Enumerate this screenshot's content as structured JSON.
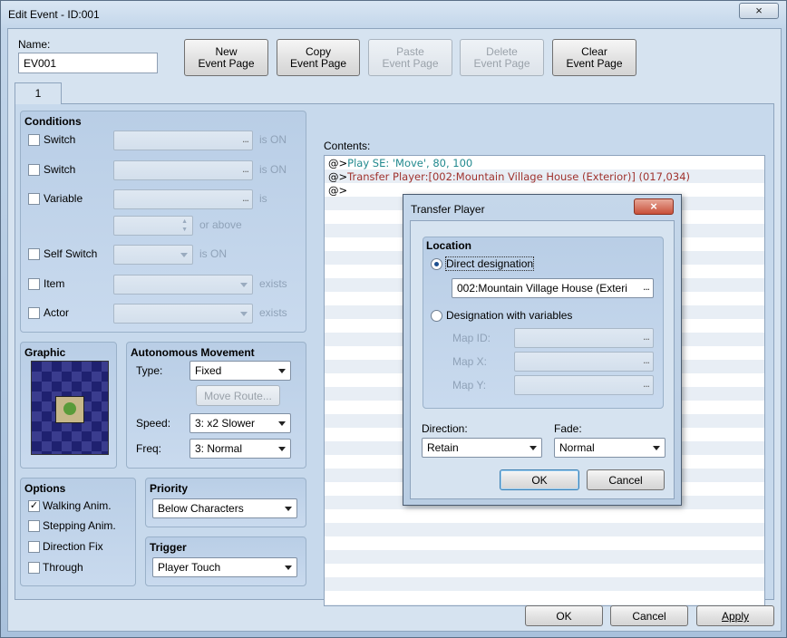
{
  "window": {
    "title": "Edit Event - ID:001",
    "close_glyph": "×"
  },
  "name": {
    "label": "Name:",
    "value": "EV001"
  },
  "toolbar": {
    "new_line1": "New",
    "new_line2": "Event Page",
    "copy_line1": "Copy",
    "copy_line2": "Event Page",
    "paste_line1": "Paste",
    "paste_line2": "Event Page",
    "delete_line1": "Delete",
    "delete_line2": "Event Page",
    "clear_line1": "Clear",
    "clear_line2": "Event Page"
  },
  "tabs": [
    {
      "label": "1"
    }
  ],
  "conditions": {
    "title": "Conditions",
    "switch1": {
      "label": "Switch",
      "suffix": "is ON",
      "value": ""
    },
    "switch2": {
      "label": "Switch",
      "suffix": "is ON",
      "value": ""
    },
    "variable": {
      "label": "Variable",
      "suffix": "is",
      "value": "",
      "compare_suffix": "or above"
    },
    "self_switch": {
      "label": "Self Switch",
      "suffix": "is ON"
    },
    "item": {
      "label": "Item",
      "suffix": "exists"
    },
    "actor": {
      "label": "Actor",
      "suffix": "exists"
    }
  },
  "graphic": {
    "title": "Graphic"
  },
  "movement": {
    "title": "Autonomous Movement",
    "type_label": "Type:",
    "type_value": "Fixed",
    "move_route": "Move Route...",
    "speed_label": "Speed:",
    "speed_value": "3: x2 Slower",
    "freq_label": "Freq:",
    "freq_value": "3: Normal"
  },
  "options": {
    "title": "Options",
    "walking": {
      "label": "Walking Anim.",
      "checked": true,
      "mark": "✓"
    },
    "stepping": {
      "label": "Stepping Anim.",
      "checked": false
    },
    "direction_fix": {
      "label": "Direction Fix",
      "checked": false
    },
    "through": {
      "label": "Through",
      "checked": false
    }
  },
  "priority": {
    "title": "Priority",
    "value": "Below Characters"
  },
  "trigger": {
    "title": "Trigger",
    "value": "Player Touch"
  },
  "contents": {
    "label": "Contents:",
    "lines": [
      {
        "prefix": "@>",
        "text": "Play SE: 'Move', 80, 100",
        "color": "#21898e"
      },
      {
        "prefix": "@>",
        "text": "Transfer Player:[002:Mountain Village House (Exterior)] (017,034)",
        "color": "#a0332e"
      },
      {
        "prefix": "@>",
        "text": ""
      }
    ]
  },
  "dialog": {
    "title": "Transfer Player",
    "close_glyph": "×",
    "location_title": "Location",
    "direct_label": "Direct designation",
    "direct_value": "002:Mountain Village House (Exteri",
    "variables_label": "Designation with variables",
    "map_id_label": "Map ID:",
    "map_x_label": "Map X:",
    "map_y_label": "Map Y:",
    "direction_label": "Direction:",
    "direction_value": "Retain",
    "fade_label": "Fade:",
    "fade_value": "Normal",
    "ok": "OK",
    "cancel": "Cancel"
  },
  "footer": {
    "ok": "OK",
    "cancel": "Cancel",
    "apply": "Apply"
  },
  "ellipsis": "..."
}
